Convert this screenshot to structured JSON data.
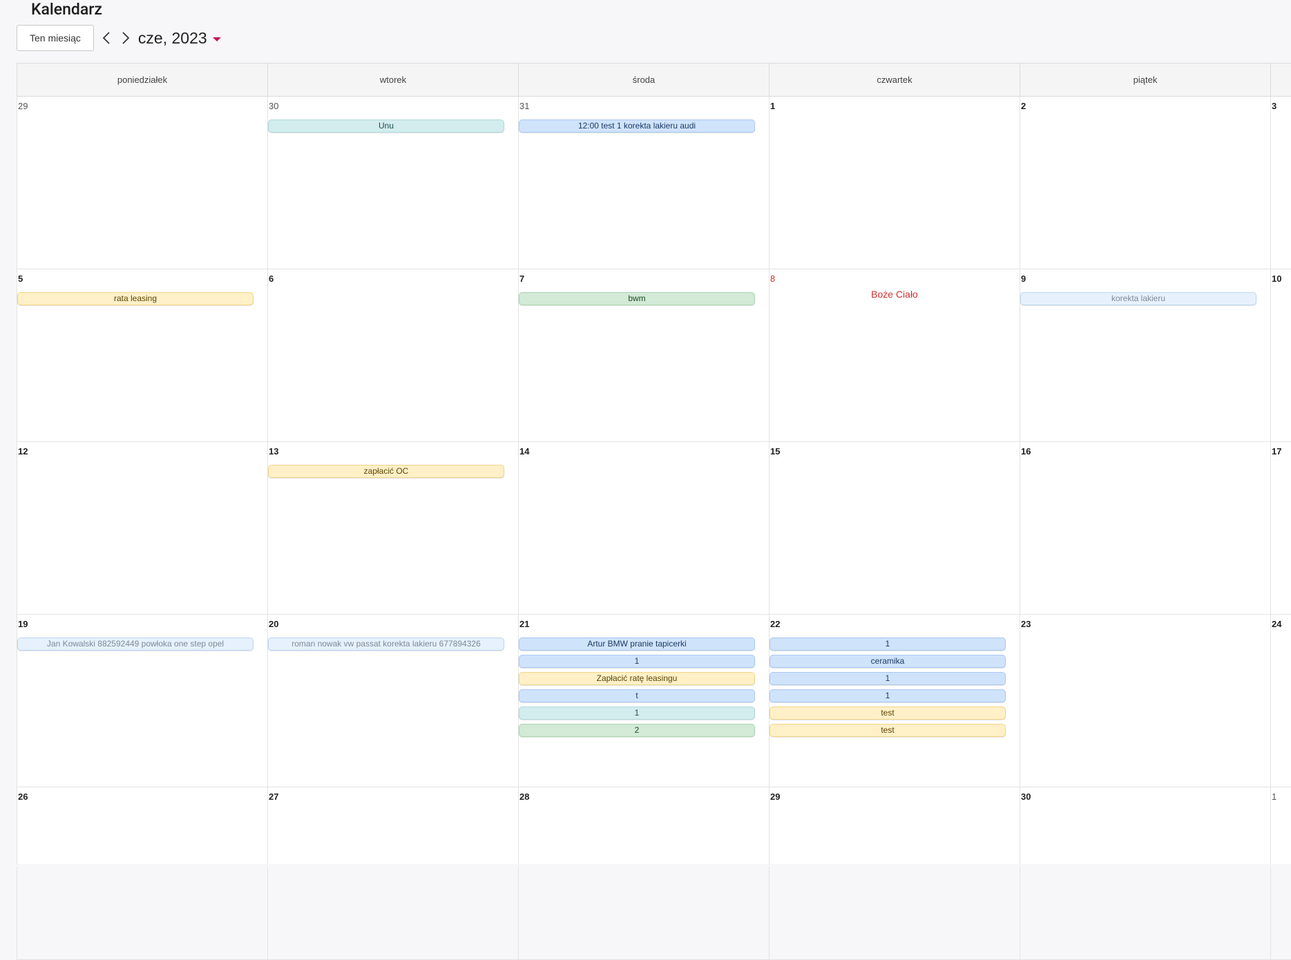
{
  "page": {
    "title": "Kalendarz"
  },
  "toolbar": {
    "today_label": "Ten miesiąc",
    "month_label": "cze, 2023",
    "caret_color": "#c2185b"
  },
  "weekdays": [
    "poniedziałek",
    "wtorek",
    "środa",
    "czwartek",
    "piątek"
  ],
  "colors": {
    "blue": "#cfe3fb",
    "teal": "#d3ecee",
    "yellow": "#fff0c7",
    "green": "#d2ead6",
    "light": "#e6f1fd",
    "holiday": "#d32f2f"
  },
  "weeks": [
    {
      "days": [
        {
          "num": "29",
          "other": true,
          "events": []
        },
        {
          "num": "30",
          "other": true,
          "events": [
            {
              "label": "Unu",
              "color": "teal"
            }
          ]
        },
        {
          "num": "31",
          "other": true,
          "events": [
            {
              "label": "12:00 test 1 korekta lakieru audi",
              "color": "blue"
            }
          ]
        },
        {
          "num": "1",
          "events": []
        },
        {
          "num": "2",
          "events": []
        },
        {
          "num": "3",
          "events": []
        }
      ]
    },
    {
      "days": [
        {
          "num": "5",
          "events": [
            {
              "label": "rata leasing",
              "color": "yellow"
            }
          ]
        },
        {
          "num": "6",
          "events": []
        },
        {
          "num": "7",
          "events": [
            {
              "label": "bwm",
              "color": "green"
            }
          ]
        },
        {
          "num": "8",
          "holiday": "Boże Ciało",
          "events": []
        },
        {
          "num": "9",
          "events": [
            {
              "label": "korekta lakieru",
              "color": "light"
            }
          ]
        },
        {
          "num": "10",
          "events": []
        }
      ]
    },
    {
      "days": [
        {
          "num": "12",
          "events": []
        },
        {
          "num": "13",
          "events": [
            {
              "label": "zapłacić OC",
              "color": "yellow"
            }
          ]
        },
        {
          "num": "14",
          "events": []
        },
        {
          "num": "15",
          "events": []
        },
        {
          "num": "16",
          "events": []
        },
        {
          "num": "17",
          "events": []
        }
      ]
    },
    {
      "days": [
        {
          "num": "19",
          "events": [
            {
              "label": "Jan Kowalski 882592449 powłoka one step opel",
              "color": "light"
            }
          ]
        },
        {
          "num": "20",
          "events": [
            {
              "label": "roman nowak vw passat korekta lakieru 677894326",
              "color": "light"
            }
          ]
        },
        {
          "num": "21",
          "events": [
            {
              "label": "Artur BMW pranie tapicerki",
              "color": "blue"
            },
            {
              "label": "1",
              "color": "blue"
            },
            {
              "label": "Zapłacić ratę leasingu",
              "color": "yellow"
            },
            {
              "label": "t",
              "color": "blue"
            },
            {
              "label": "1",
              "color": "teal"
            },
            {
              "label": "2",
              "color": "green"
            }
          ]
        },
        {
          "num": "22",
          "events": [
            {
              "label": "1",
              "color": "blue"
            },
            {
              "label": "ceramika",
              "color": "blue"
            },
            {
              "label": "1",
              "color": "blue"
            },
            {
              "label": "1",
              "color": "blue"
            },
            {
              "label": "test",
              "color": "yellow"
            },
            {
              "label": "test",
              "color": "yellow"
            }
          ]
        },
        {
          "num": "23",
          "events": []
        },
        {
          "num": "24",
          "events": []
        }
      ]
    },
    {
      "days": [
        {
          "num": "26",
          "events": []
        },
        {
          "num": "27",
          "events": []
        },
        {
          "num": "28",
          "events": []
        },
        {
          "num": "29",
          "events": []
        },
        {
          "num": "30",
          "events": []
        },
        {
          "num": "1",
          "other": true,
          "events": []
        }
      ]
    }
  ]
}
